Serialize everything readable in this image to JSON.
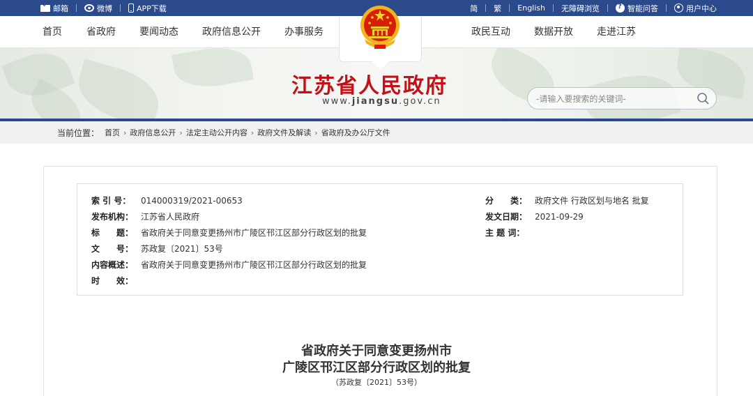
{
  "topbar": {
    "left": [
      {
        "label": "邮箱",
        "icon": "mail-icon"
      },
      {
        "label": "微博",
        "icon": "weibo-icon"
      },
      {
        "label": "APP下载",
        "icon": "phone-icon"
      }
    ],
    "right": [
      {
        "label": "简"
      },
      {
        "label": "繁"
      },
      {
        "label": "English"
      },
      {
        "label": "无障碍浏览"
      },
      {
        "label": "智能问答",
        "icon": "qa-icon"
      },
      {
        "label": "用户中心",
        "icon": "user-icon"
      }
    ]
  },
  "nav": {
    "items": [
      "首页",
      "省政府",
      "要闻动态",
      "政府信息公开",
      "办事服务",
      "政民互动",
      "数据开放",
      "走进江苏"
    ]
  },
  "banner": {
    "title": "江苏省人民政府",
    "url_prefix": "www.",
    "url_domain": "jiangsu",
    "url_suffix": ".gov.cn"
  },
  "search": {
    "placeholder": "-请输入要搜索的关键词-"
  },
  "breadcrumb": {
    "label": "当前位置：",
    "items": [
      "首页",
      "政府信息公开",
      "法定主动公开内容",
      "政府文件及解读",
      "省政府及办公厅文件"
    ]
  },
  "meta": {
    "index_label": "索 引 号：",
    "index_value": "014000319/2021-00653",
    "category_label": "分　　类：",
    "category_value": "政府文件 行政区划与地名 批复",
    "issuer_label": "发布机构：",
    "issuer_value": "江苏省人民政府",
    "date_label": "发文日期：",
    "date_value": "2021-09-29",
    "title_label": "标　　题：",
    "title_value": "省政府关于同意变更扬州市广陵区邗江区部分行政区划的批复",
    "subject_label": "主 题 词：",
    "subject_value": "",
    "docno_label": "文　　号：",
    "docno_value": "苏政复〔2021〕53号",
    "summary_label": "内容概述：",
    "summary_value": "省政府关于同意变更扬州市广陵区邗江区部分行政区划的批复",
    "validity_label": "时　　效：",
    "validity_value": ""
  },
  "document": {
    "title_line1": "省政府关于同意变更扬州市",
    "title_line2": "广陵区邗江区部分行政区划的批复",
    "number": "（苏政复〔2021〕53号）"
  },
  "colors": {
    "topbar": "#2b4a8b",
    "title_red": "#c1121a"
  }
}
